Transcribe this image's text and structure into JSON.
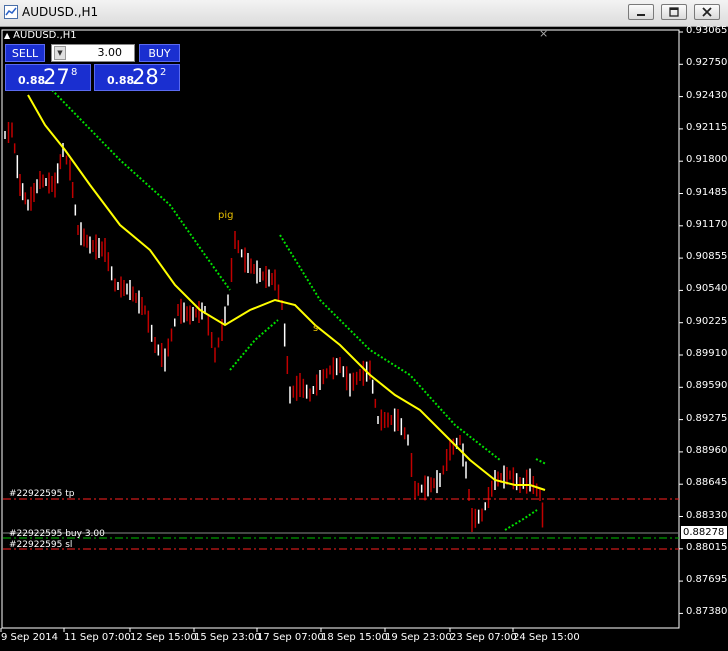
{
  "window": {
    "title": "AUDUSD.,H1",
    "icon": "chart-window-icon"
  },
  "window_buttons": [
    {
      "name": "minimize-button",
      "icon": "minimize-icon"
    },
    {
      "name": "restore-button",
      "icon": "restore-icon"
    },
    {
      "name": "close-button",
      "icon": "close-icon"
    }
  ],
  "chart": {
    "symbol_label": "AUDUSD.,H1",
    "close_glyph": "×",
    "colors": {
      "background": "#000000",
      "bull_candle": "#ffffff",
      "bear_candle": "#c00000",
      "ma": "#ffff00",
      "psar": "#00e000",
      "tp_sl": "#ff2020",
      "entry": "#00c000",
      "axis": "#ffffff"
    }
  },
  "one_click": {
    "sell_label": "SELL",
    "buy_label": "BUY",
    "lot_value": "3.00",
    "lot_arrow": "▼",
    "sell_price_small": "0.88",
    "sell_price_big": "27",
    "sell_price_sup": "8",
    "buy_price_small": "0.88",
    "buy_price_big": "28",
    "buy_price_sup": "2"
  },
  "price_axis": {
    "labels": [
      "0.93065",
      "0.92750",
      "0.92430",
      "0.92115",
      "0.91800",
      "0.91485",
      "0.91170",
      "0.90855",
      "0.90540",
      "0.90225",
      "0.89910",
      "0.89590",
      "0.89275",
      "0.88960",
      "0.88645",
      "0.88330",
      "0.88015",
      "0.87695",
      "0.87380"
    ],
    "current_price": "0.88278"
  },
  "time_axis": {
    "labels": [
      "9 Sep 2014",
      "11 Sep 07:00",
      "12 Sep 15:00",
      "15 Sep 23:00",
      "17 Sep 07:00",
      "18 Sep 15:00",
      "19 Sep 23:00",
      "23 Sep 07:00",
      "24 Sep 15:00"
    ]
  },
  "orders": {
    "tp_label": "#22922595 tp",
    "buy_label": "#22922595 buy 3.00",
    "sl_label": "#22922595 sl"
  },
  "annotations": {
    "pig": "pig",
    "s": "s"
  }
}
